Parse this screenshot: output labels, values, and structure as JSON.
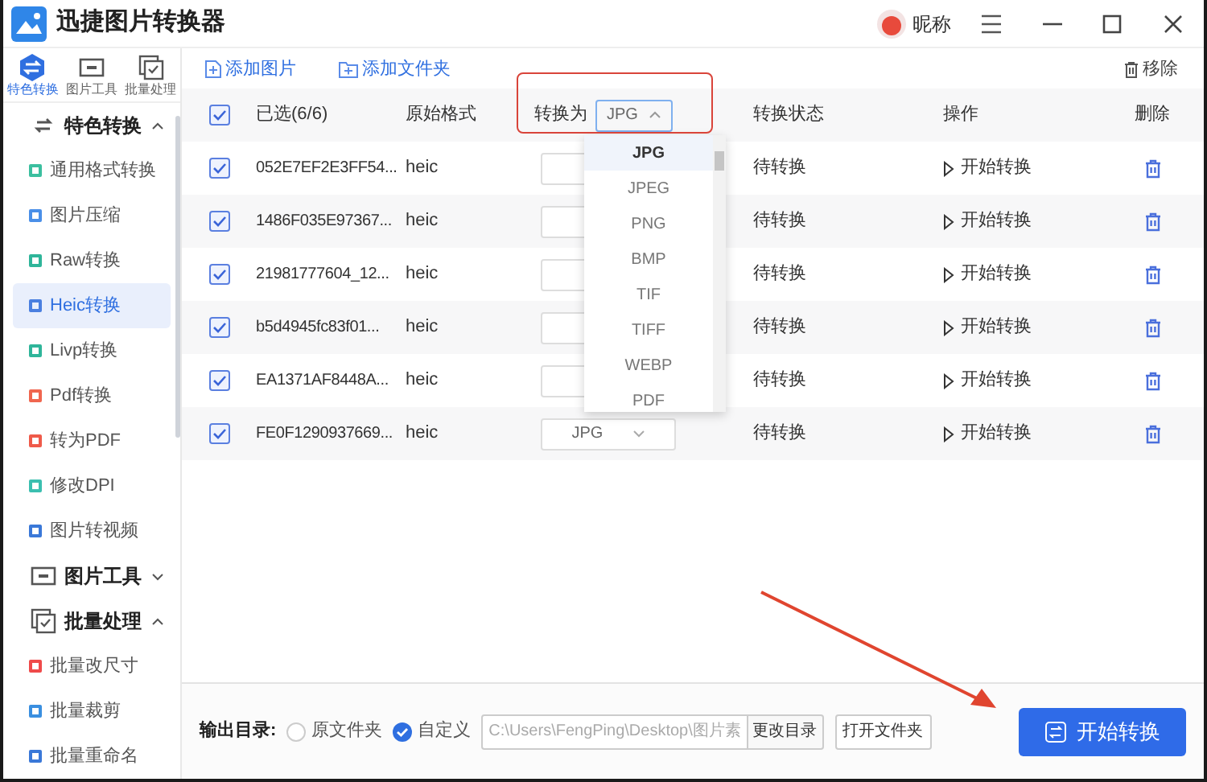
{
  "window": {
    "title": "迅捷图片转换器",
    "user_name": "昵称"
  },
  "sidebar": {
    "tabs": [
      {
        "label": "特色转换",
        "selected": true,
        "kind": "swap"
      },
      {
        "label": "图片工具",
        "selected": false,
        "kind": "tool"
      },
      {
        "label": "批量处理",
        "selected": false,
        "kind": "batch"
      }
    ],
    "groups": [
      {
        "label": "特色转换",
        "expanded": true,
        "kind": "swap",
        "items": [
          {
            "label": "通用格式转换",
            "selected": false,
            "color": "#3bbf9f"
          },
          {
            "label": "图片压缩",
            "selected": false,
            "color": "#4a8fe8"
          },
          {
            "label": "Raw转换",
            "selected": false,
            "color": "#2fb59a"
          },
          {
            "label": "Heic转换",
            "selected": true,
            "color": "#4a7fe0"
          },
          {
            "label": "Livp转换",
            "selected": false,
            "color": "#2fb59a"
          },
          {
            "label": "Pdf转换",
            "selected": false,
            "color": "#f0664f"
          },
          {
            "label": "转为PDF",
            "selected": false,
            "color": "#ef5a4a"
          },
          {
            "label": "修改DPI",
            "selected": false,
            "color": "#3bbfb0"
          },
          {
            "label": "图片转视频",
            "selected": false,
            "color": "#3a78d8"
          }
        ]
      },
      {
        "label": "图片工具",
        "expanded": false,
        "kind": "tool"
      },
      {
        "label": "批量处理",
        "expanded": true,
        "kind": "batch",
        "items": [
          {
            "label": "批量改尺寸",
            "selected": false,
            "color": "#ef4a4a"
          },
          {
            "label": "批量裁剪",
            "selected": false,
            "color": "#3a8fe0"
          },
          {
            "label": "批量重命名",
            "selected": false,
            "color": "#3a78d8"
          }
        ]
      }
    ]
  },
  "toolbar": {
    "add_image": "添加图片",
    "add_folder": "添加文件夹",
    "remove": "移除"
  },
  "table": {
    "header": {
      "checked": true,
      "selected_count": "已选(6/6)",
      "format": "原始格式",
      "convert_to": "转换为",
      "convert_to_value": "JPG",
      "status": "转换状态",
      "action": "操作",
      "delete": "删除"
    },
    "rows": [
      {
        "checked": true,
        "name": "052E7EF2E3FF54...",
        "format": "heic",
        "status": "待转换",
        "action": "开始转换"
      },
      {
        "checked": true,
        "name": "1486F035E97367...",
        "format": "heic",
        "status": "待转换",
        "action": "开始转换"
      },
      {
        "checked": true,
        "name": "21981777604_12...",
        "format": "heic",
        "status": "待转换",
        "action": "开始转换"
      },
      {
        "checked": true,
        "name": "b5d4945fc83f01...",
        "format": "heic",
        "status": "待转换",
        "action": "开始转换"
      },
      {
        "checked": true,
        "name": "EA1371AF8448A...",
        "format": "heic",
        "status": "待转换",
        "action": "开始转换"
      },
      {
        "checked": true,
        "name": "FE0F1290937669...",
        "format": "heic",
        "target": "JPG",
        "status": "待转换",
        "action": "开始转换"
      }
    ]
  },
  "dropdown": {
    "options": [
      {
        "label": "JPG",
        "selected": true
      },
      {
        "label": "JPEG",
        "selected": false
      },
      {
        "label": "PNG",
        "selected": false
      },
      {
        "label": "BMP",
        "selected": false
      },
      {
        "label": "TIF",
        "selected": false
      },
      {
        "label": "TIFF",
        "selected": false
      },
      {
        "label": "WEBP",
        "selected": false
      },
      {
        "label": "PDF",
        "selected": false
      }
    ]
  },
  "output": {
    "label": "输出目录:",
    "options": [
      {
        "label": "原文件夹",
        "selected": false
      },
      {
        "label": "自定义",
        "selected": true
      }
    ],
    "path": "C:\\Users\\FengPing\\Desktop\\图片素",
    "change_dir": "更改目录",
    "open_folder": "打开文件夹"
  },
  "start_button": "开始转换"
}
